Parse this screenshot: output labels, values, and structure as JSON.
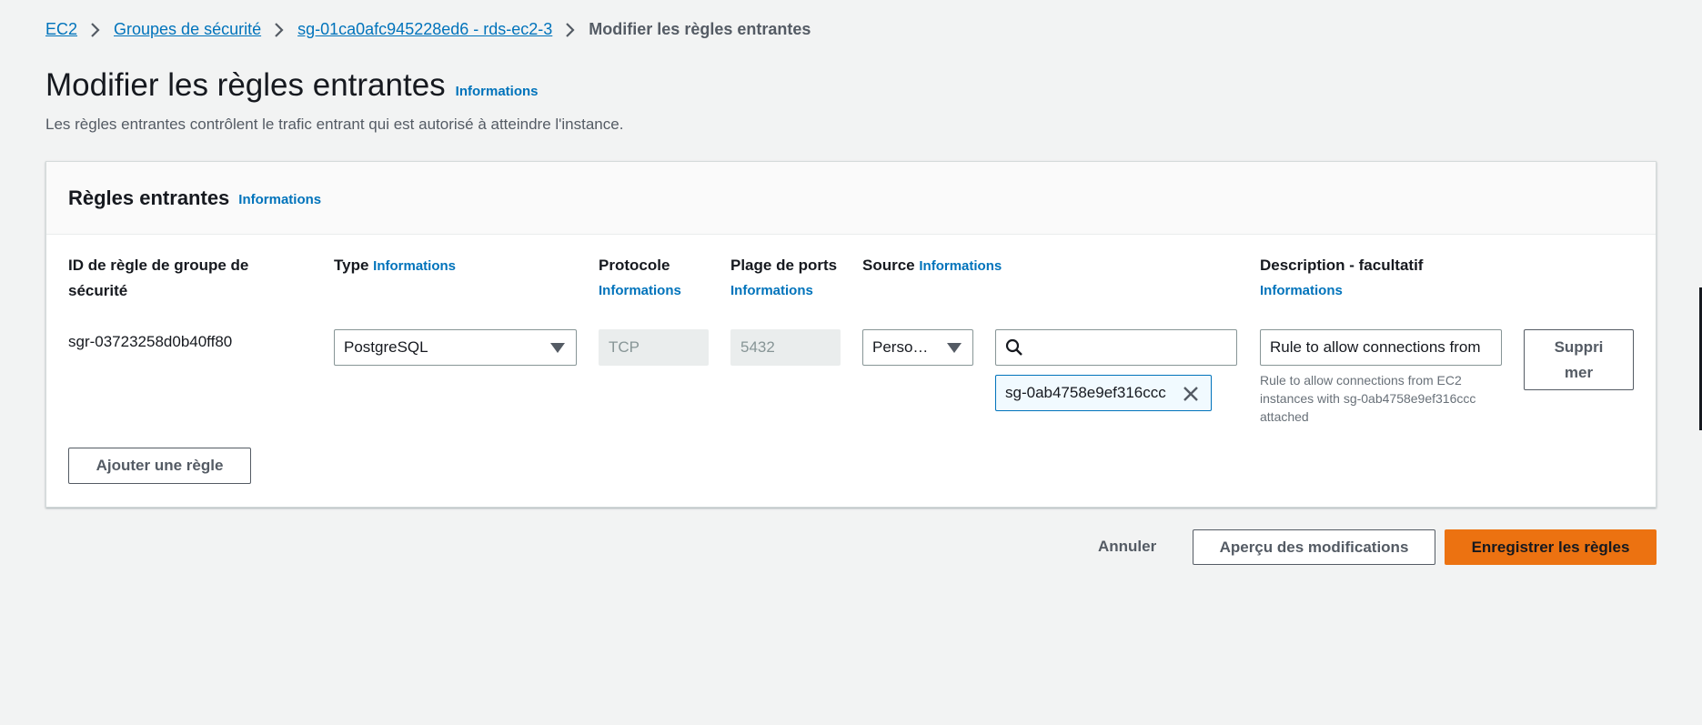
{
  "breadcrumb": {
    "items": [
      "EC2",
      "Groupes de sécurité",
      "sg-01ca0afc945228ed6 - rds-ec2-3"
    ],
    "current": "Modifier les règles entrantes"
  },
  "header": {
    "title": "Modifier les règles entrantes",
    "info": "Informations",
    "description": "Les règles entrantes contrôlent le trafic entrant qui est autorisé à atteindre l'instance."
  },
  "card": {
    "title": "Règles entrantes",
    "info": "Informations"
  },
  "columns": {
    "rule_id": "ID de règle de groupe de sécurité",
    "type": "Type",
    "protocol": "Protocole",
    "port_range": "Plage de ports",
    "source": "Source",
    "description": "Description - facultatif",
    "info": "Informations"
  },
  "rule": {
    "id": "sgr-03723258d0b40ff80",
    "type": "PostgreSQL",
    "protocol": "TCP",
    "port": "5432",
    "source_mode": "Perso…",
    "source_search": "",
    "source_token": "sg-0ab4758e9ef316ccc",
    "description": "Rule to allow connections from",
    "description_hint": [
      "Rule to allow connections from EC2",
      "instances with sg-0ab4758e9ef316ccc",
      "attached"
    ],
    "delete_label": [
      "Suppri",
      "mer"
    ]
  },
  "actions": {
    "add_rule": "Ajouter une règle",
    "cancel": "Annuler",
    "preview": "Aperçu des modifications",
    "save": "Enregistrer les règles"
  },
  "colors": {
    "link": "#0073bb",
    "primary": "#ec7211",
    "background": "#f2f3f3"
  }
}
